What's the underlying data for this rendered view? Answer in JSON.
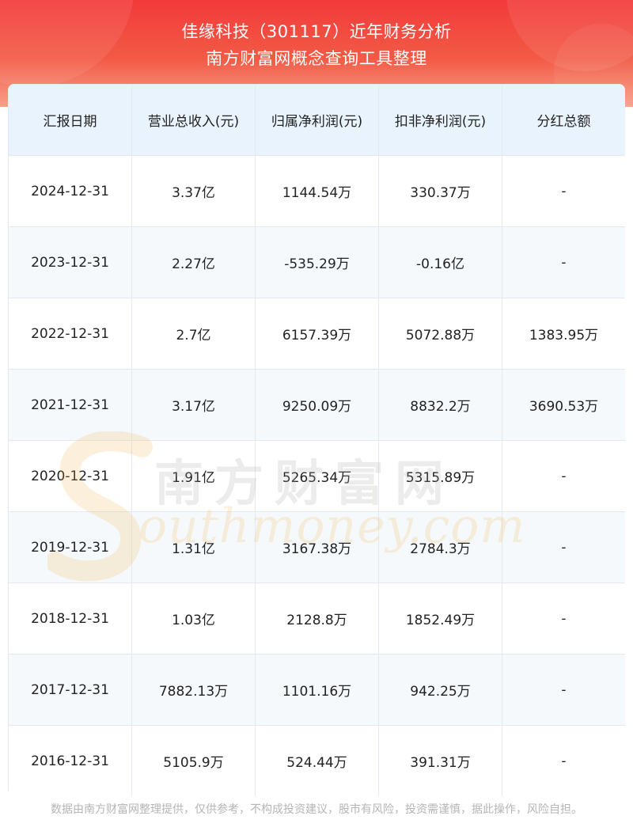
{
  "header": {
    "title_line1": "佳缘科技（301117）近年财务分析",
    "title_line2": "南方财富网概念查询工具整理"
  },
  "table": {
    "columns": [
      "汇报日期",
      "营业总收入(元)",
      "归属净利润(元)",
      "扣非净利润(元)",
      "分红总额"
    ],
    "rows": [
      [
        "2024-12-31",
        "3.37亿",
        "1144.54万",
        "330.37万",
        "-"
      ],
      [
        "2023-12-31",
        "2.27亿",
        "-535.29万",
        "-0.16亿",
        "-"
      ],
      [
        "2022-12-31",
        "2.7亿",
        "6157.39万",
        "5072.88万",
        "1383.95万"
      ],
      [
        "2021-12-31",
        "3.17亿",
        "9250.09万",
        "8832.2万",
        "3690.53万"
      ],
      [
        "2020-12-31",
        "1.91亿",
        "5265.34万",
        "5315.89万",
        "-"
      ],
      [
        "2019-12-31",
        "1.31亿",
        "3167.38万",
        "2784.3万",
        "-"
      ],
      [
        "2018-12-31",
        "1.03亿",
        "2128.8万",
        "1852.49万",
        "-"
      ],
      [
        "2017-12-31",
        "7882.13万",
        "1101.16万",
        "942.25万",
        "-"
      ],
      [
        "2016-12-31",
        "5105.9万",
        "524.44万",
        "391.31万",
        "-"
      ]
    ]
  },
  "watermark": {
    "cn": "南方财富网",
    "en": "outhmoney.com"
  },
  "footer": {
    "disclaimer": "数据由南方财富网整理提供，仅供参考，不构成投资建议，股市有风险，投资需谨慎，据此操作，风险自担。"
  },
  "colors": {
    "header_red": "#f23a3a",
    "table_header_bg": "#e9f3fd",
    "stripe_bg": "#f6f9fc",
    "border": "#e4e9f0",
    "footer_text": "#b5b5b5"
  }
}
